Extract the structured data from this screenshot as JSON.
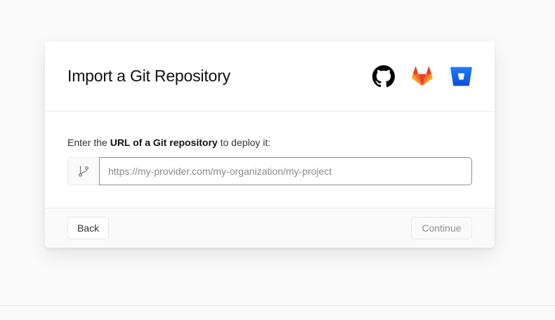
{
  "dialog": {
    "title": "Import a Git Repository",
    "providers": [
      {
        "name": "GitHub",
        "icon": "github-icon",
        "color": "#000000"
      },
      {
        "name": "GitLab",
        "icon": "gitlab-icon",
        "color": "#e24329"
      },
      {
        "name": "Bitbucket",
        "icon": "bitbucket-icon",
        "color": "#1565f0"
      }
    ]
  },
  "form": {
    "prompt_prefix": "Enter the ",
    "prompt_bold": "URL of a Git repository",
    "prompt_suffix": " to deploy it:",
    "url_value": "",
    "url_placeholder": "https://my-provider.com/my-organization/my-project",
    "prefix_icon": "git-branch-icon"
  },
  "footer": {
    "back_label": "Back",
    "continue_label": "Continue",
    "continue_disabled": true
  }
}
